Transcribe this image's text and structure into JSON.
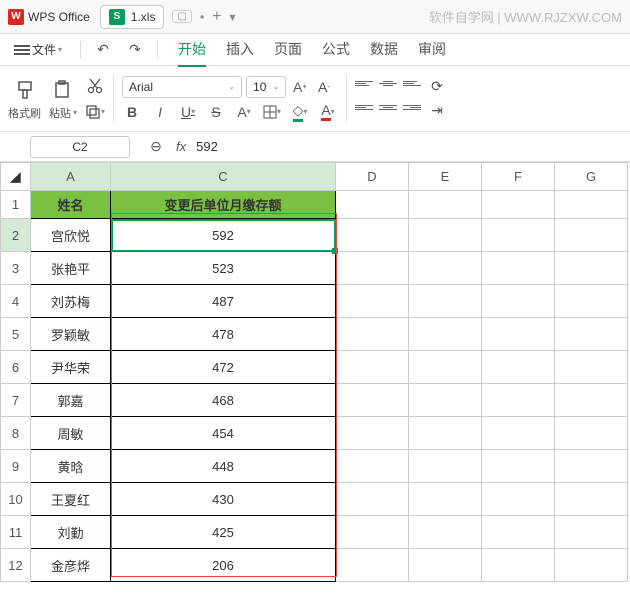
{
  "title": {
    "app": "WPS Office",
    "file": "1.xls",
    "watermark": "软件自学网 | WWW.RJZXW.COM"
  },
  "menu": {
    "file": "文件",
    "tabs": [
      "开始",
      "插入",
      "页面",
      "公式",
      "数据",
      "审阅"
    ],
    "active": 0
  },
  "ribbon": {
    "format_brush": "格式刷",
    "paste": "粘贴",
    "font": "Arial",
    "size": "10",
    "bold": "B",
    "italic": "I",
    "underline": "U",
    "strike": "S"
  },
  "namebox": "C2",
  "fx": "fx",
  "fx_val": "592",
  "cols": [
    "A",
    "C",
    "D",
    "E",
    "F",
    "G"
  ],
  "header": {
    "a": "姓名",
    "c": "变更后单位月缴存额"
  },
  "rows": [
    {
      "n": 2,
      "a": "宫欣悦",
      "c": "592"
    },
    {
      "n": 3,
      "a": "张艳平",
      "c": "523"
    },
    {
      "n": 4,
      "a": "刘苏梅",
      "c": "487"
    },
    {
      "n": 5,
      "a": "罗颖敏",
      "c": "478"
    },
    {
      "n": 6,
      "a": "尹华荣",
      "c": "472"
    },
    {
      "n": 7,
      "a": "郭嘉",
      "c": "468"
    },
    {
      "n": 8,
      "a": "周敏",
      "c": "454"
    },
    {
      "n": 9,
      "a": "黄晗",
      "c": "448"
    },
    {
      "n": 10,
      "a": "王夏红",
      "c": "430"
    },
    {
      "n": 11,
      "a": "刘勤",
      "c": "425"
    },
    {
      "n": 12,
      "a": "金彦烨",
      "c": "206"
    }
  ],
  "chart_data": {
    "type": "table",
    "title": "变更后单位月缴存额",
    "columns": [
      "姓名",
      "变更后单位月缴存额"
    ],
    "data": [
      [
        "宫欣悦",
        592
      ],
      [
        "张艳平",
        523
      ],
      [
        "刘苏梅",
        487
      ],
      [
        "罗颖敏",
        478
      ],
      [
        "尹华荣",
        472
      ],
      [
        "郭嘉",
        468
      ],
      [
        "周敏",
        454
      ],
      [
        "黄晗",
        448
      ],
      [
        "王夏红",
        430
      ],
      [
        "刘勤",
        425
      ],
      [
        "金彦烨",
        206
      ]
    ]
  }
}
